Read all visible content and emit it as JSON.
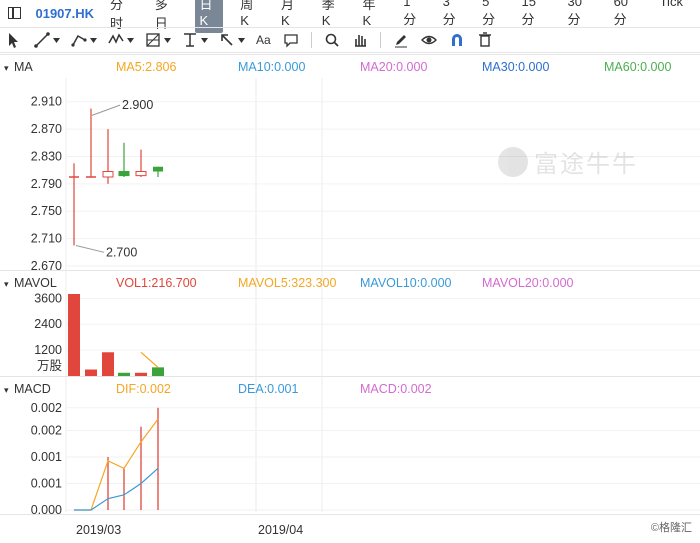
{
  "symbol": "01907.HK",
  "periods": [
    "分时",
    "多日",
    "日K",
    "周K",
    "月K",
    "季K",
    "年K",
    "1分",
    "3分",
    "5分",
    "15分",
    "30分",
    "60分",
    "Tick"
  ],
  "active_period": "日K",
  "toolbar": {
    "icons": [
      "cursor-icon",
      "line-tool-icon",
      "polyline-tool-icon",
      "wave-tool-icon",
      "fib-tool-icon",
      "horizontal-line-icon",
      "arrow-icon",
      "text-tool-icon",
      "comment-icon",
      "search-icon",
      "hand-icon",
      "pen-icon",
      "eye-icon",
      "magnet-icon",
      "trash-icon"
    ],
    "text_tool_label": "Aa"
  },
  "main_panel": {
    "name": "MA",
    "indicators": [
      {
        "label": "MA5:2.806",
        "color": "#f5a623"
      },
      {
        "label": "MA10:0.000",
        "color": "#3a9ad9"
      },
      {
        "label": "MA20:0.000",
        "color": "#d36bd1"
      },
      {
        "label": "MA30:0.000",
        "color": "#2d6fcf"
      },
      {
        "label": "MA60:0.000",
        "color": "#4caf50"
      }
    ],
    "y_ticks": [
      "2.910",
      "2.870",
      "2.830",
      "2.790",
      "2.750",
      "2.710",
      "2.670"
    ],
    "high_label": "2.900",
    "low_label": "2.700"
  },
  "vol_panel": {
    "name": "MAVOL",
    "indicators": [
      {
        "label": "VOL1:216.700",
        "color": "#e0463c"
      },
      {
        "label": "MAVOL5:323.300",
        "color": "#f5a623"
      },
      {
        "label": "MAVOL10:0.000",
        "color": "#3a9ad9"
      },
      {
        "label": "MAVOL20:0.000",
        "color": "#d36bd1"
      }
    ],
    "y_ticks": [
      "3600",
      "2400",
      "1200"
    ],
    "unit": "万股"
  },
  "macd_panel": {
    "name": "MACD",
    "indicators": [
      {
        "label": "DIF:0.002",
        "color": "#f5a623"
      },
      {
        "label": "DEA:0.001",
        "color": "#3a9ad9"
      },
      {
        "label": "MACD:0.002",
        "color": "#d36bd1"
      }
    ],
    "y_ticks": [
      "0.002",
      "0.002",
      "0.001",
      "0.001",
      "0.000"
    ]
  },
  "x_labels": [
    "2019/03",
    "2019/04"
  ],
  "watermark": "富途牛牛",
  "corner_text": "©格隆汇",
  "colors": {
    "up": "#e0463c",
    "down": "#3aa33a",
    "accent": "#2f6fcf"
  },
  "chart_data": {
    "type": "candlestick",
    "candles": [
      {
        "open": 2.8,
        "close": 2.8,
        "high": 2.82,
        "low": 2.7
      },
      {
        "open": 2.8,
        "close": 2.8,
        "high": 2.9,
        "low": 2.8
      },
      {
        "open": 2.8,
        "close": 2.808,
        "high": 2.87,
        "low": 2.79
      },
      {
        "open": 2.808,
        "close": 2.802,
        "high": 2.85,
        "low": 2.8
      },
      {
        "open": 2.802,
        "close": 2.808,
        "high": 2.84,
        "low": 2.8
      },
      {
        "open": 2.815,
        "close": 2.808,
        "high": 2.815,
        "low": 2.8
      }
    ],
    "price_ylim": [
      2.67,
      2.93
    ],
    "volume": [
      {
        "value": 3800,
        "dir": "up"
      },
      {
        "value": 300,
        "dir": "up"
      },
      {
        "value": 1100,
        "dir": "up"
      },
      {
        "value": 150,
        "dir": "down"
      },
      {
        "value": 150,
        "dir": "up"
      },
      {
        "value": 400,
        "dir": "down"
      }
    ],
    "mavol5": [
      null,
      null,
      null,
      null,
      1100,
      400
    ],
    "vol_ylim": [
      0,
      3800
    ],
    "dif": [
      0.0,
      0.0,
      0.0013,
      0.0011,
      0.0018,
      0.0024
    ],
    "dea": [
      0.0,
      0.0,
      0.0003,
      0.0004,
      0.0007,
      0.0011
    ],
    "macd_hist": [
      0.0,
      0.0,
      0.0014,
      0.0011,
      0.0022,
      0.0027
    ],
    "macd_ylim": [
      0.0,
      0.0028
    ]
  }
}
